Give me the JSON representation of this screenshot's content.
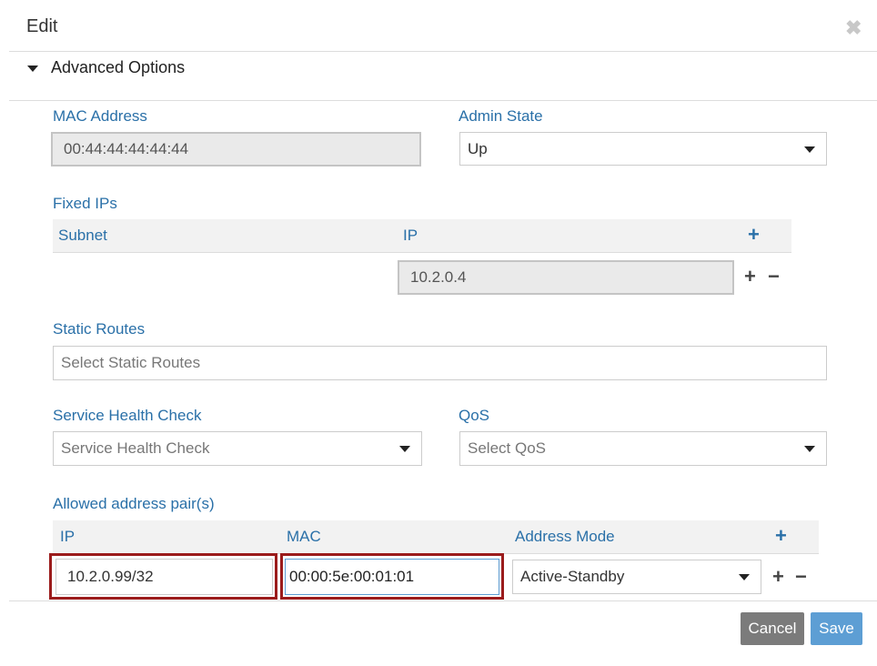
{
  "dialog": {
    "title": "Edit"
  },
  "section": {
    "label": "Advanced Options"
  },
  "mac_address": {
    "label": "MAC Address",
    "value": "00:44:44:44:44:44"
  },
  "admin_state": {
    "label": "Admin State",
    "value": "Up"
  },
  "fixed_ips": {
    "label": "Fixed IPs",
    "columns": {
      "subnet": "Subnet",
      "ip": "IP"
    },
    "rows": [
      {
        "ip": "10.2.0.4"
      }
    ]
  },
  "static_routes": {
    "label": "Static Routes",
    "placeholder": "Select Static Routes"
  },
  "service_health_check": {
    "label": "Service Health Check",
    "placeholder": "Service Health Check"
  },
  "qos": {
    "label": "QoS",
    "placeholder": "Select QoS"
  },
  "allowed_address_pairs": {
    "label": "Allowed address pair(s)",
    "columns": {
      "ip": "IP",
      "mac": "MAC",
      "address_mode": "Address Mode"
    },
    "rows": [
      {
        "ip": "10.2.0.99/32",
        "mac": "00:00:5e:00:01:01",
        "address_mode": "Active-Standby"
      }
    ]
  },
  "icons": {
    "plus": "+",
    "minus": "−",
    "close": "✖"
  },
  "buttons": {
    "cancel": "Cancel",
    "save": "Save"
  },
  "colors": {
    "label_blue": "#2a70a8",
    "highlight_red": "#9b1c1c",
    "save_blue": "#5d9ed4",
    "cancel_gray": "#7b7b7b"
  }
}
